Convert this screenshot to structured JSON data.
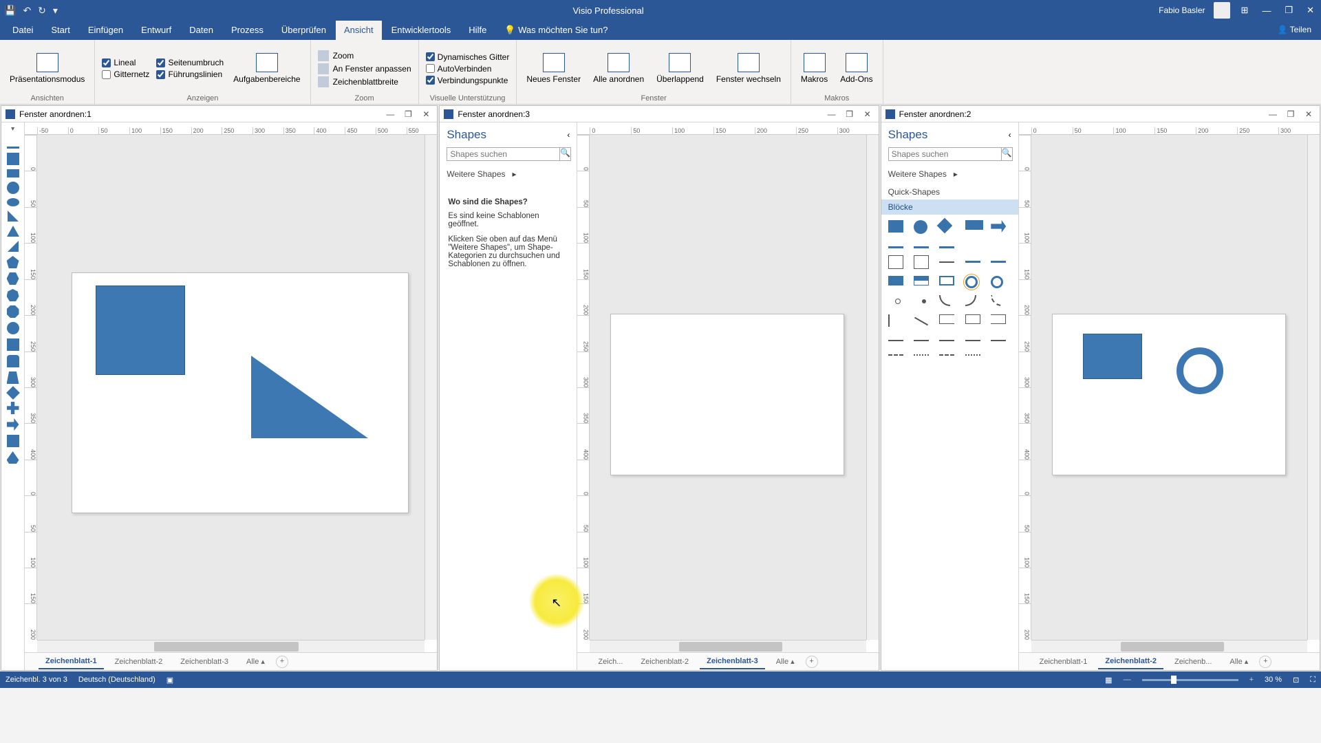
{
  "app": {
    "title": "Visio Professional",
    "user": "Fabio Basler",
    "share": "Teilen"
  },
  "qat": {
    "save": "💾",
    "undo": "↶",
    "redo": "↻",
    "more": "▾"
  },
  "winctrl": {
    "opt": "⊞",
    "min": "—",
    "restore": "❐",
    "close": "✕"
  },
  "tabs": {
    "datei": "Datei",
    "start": "Start",
    "einfuegen": "Einfügen",
    "entwurf": "Entwurf",
    "daten": "Daten",
    "prozess": "Prozess",
    "ueberpruefen": "Überprüfen",
    "ansicht": "Ansicht",
    "entwicklertools": "Entwicklertools",
    "hilfe": "Hilfe",
    "tellme": "Was möchten Sie tun?"
  },
  "ribbon": {
    "ansichten": {
      "label": "Ansichten",
      "praesentation": "Präsentationsmodus"
    },
    "anzeigen": {
      "label": "Anzeigen",
      "lineal": "Lineal",
      "seitenumbruch": "Seitenumbruch",
      "gitternetz": "Gitternetz",
      "fuehrungslinien": "Führungslinien",
      "aufgabenbereiche": "Aufgabenbereiche"
    },
    "zoom": {
      "label": "Zoom",
      "zoom": "Zoom",
      "anfenster": "An Fenster anpassen",
      "zeichenblattbreite": "Zeichenblattbreite"
    },
    "visuelle": {
      "label": "Visuelle Unterstützung",
      "dyn": "Dynamisches Gitter",
      "auto": "AutoVerbinden",
      "verbind": "Verbindungspunkte"
    },
    "fenster": {
      "label": "Fenster",
      "neues": "Neues Fenster",
      "alle": "Alle anordnen",
      "ueberlappend": "Überlappend",
      "wechseln": "Fenster wechseln"
    },
    "makros": {
      "label": "Makros",
      "makros": "Makros",
      "addons": "Add-Ons"
    }
  },
  "panes": {
    "p1": {
      "title": "Fenster anordnen:1"
    },
    "p2": {
      "title": "Fenster anordnen:3"
    },
    "p3": {
      "title": "Fenster anordnen:2"
    }
  },
  "shapes": {
    "title": "Shapes",
    "search_ph": "Shapes suchen",
    "more": "Weitere Shapes",
    "quick": "Quick-Shapes",
    "bloecke": "Blöcke",
    "collapse": "‹",
    "msg_title": "Wo sind die Shapes?",
    "msg_l1": "Es sind keine Schablonen geöffnet.",
    "msg_l2": "Klicken Sie oben auf das Menü \"Weitere Shapes\", um Shape-Kategorien zu durchsuchen und Schablonen zu öffnen."
  },
  "pagetabs": {
    "z1": "Zeichenblatt-1",
    "z2": "Zeichenblatt-2",
    "z3": "Zeichenblatt-3",
    "zs": "Zeich...",
    "zb": "Zeichenb...",
    "alle": "Alle"
  },
  "status": {
    "page": "Zeichenbl. 3 von 3",
    "lang": "Deutsch (Deutschland)",
    "zoom": "30 %"
  },
  "rulers": {
    "h1": [
      "-50",
      "0",
      "50",
      "100",
      "150",
      "200",
      "250",
      "300",
      "350",
      "400",
      "450",
      "500",
      "550"
    ],
    "h2": [
      "0",
      "50",
      "100",
      "150",
      "200",
      "250",
      "300"
    ],
    "v": [
      "0",
      "50",
      "100",
      "150",
      "200",
      "250",
      "300",
      "350",
      "400"
    ]
  }
}
